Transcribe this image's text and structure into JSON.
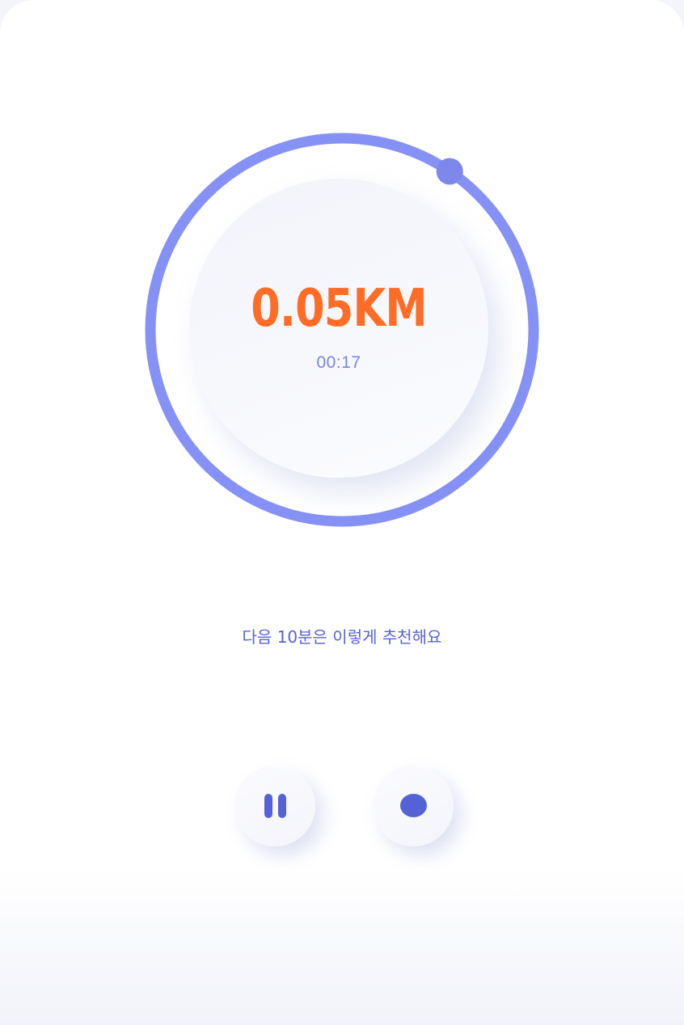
{
  "tracker": {
    "distance": "0.05KM",
    "elapsed_time": "00:17",
    "progress_fraction": 0.095,
    "ring_color": "#8591f5",
    "knob_color": "#7d88ea",
    "distance_color": "#ff6c26"
  },
  "recommendation": {
    "text": "다음 10분은 이렇게 추천해요"
  },
  "controls": {
    "pause_icon": "pause-icon",
    "stop_icon": "stop-icon",
    "accent_color": "#5562d6"
  }
}
